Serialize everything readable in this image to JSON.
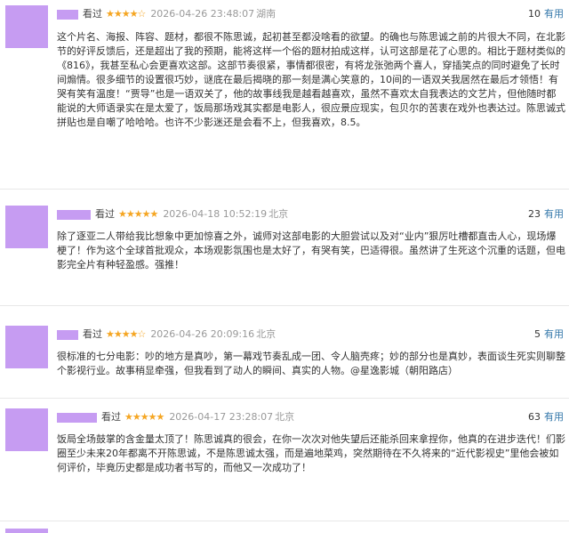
{
  "reviews": [
    {
      "label": "看过",
      "stars": "★★★★☆",
      "date": "2026-04-26 23:48:07",
      "location": "湖南",
      "useful_count": "10",
      "useful_label": "有用",
      "text": "这个片名、海报、阵容、题材，都很不陈思诚，起初甚至都没啥看的欲望。的确也与陈思诚之前的片很大不同，在北影节的好评反馈后，还是超出了我的预期，能将这样一个俗的题材拍成这样，认可这部是花了心思的。相比于题材类似的《816》，我甚至私心会更喜欢这部。这部节奏很紧，事情都很密，有将龙张弛两个喜人，穿插笑点的同时避免了长时间煽情。很多细节的设置很巧妙，谜底在最后揭晓的那一刻是满心笑意的，10间的一语双关我居然在最后才领悟！有哭有笑有温度！“贾导”也是一语双关了，他的故事线我是越看越喜欢，虽然不喜欢太自我表达的文艺片，但他随时都能说的大师语录实在是太爱了，饭局那场戏其实都是电影人，很应景应现实，包贝尔的苦衷在戏外也表达过。陈思诚式拼贴也是自嘲了哈哈哈。也许不少影迷还是会看不上，但我喜欢，8.5。"
    },
    {
      "label": "看过",
      "stars": "★★★★★",
      "date": "2026-04-18 10:52:19",
      "location": "北京",
      "useful_count": "23",
      "useful_label": "有用",
      "text": "除了逐亚二人带给我比想象中更加惊喜之外，诚师对这部电影的大胆尝试以及对“业内”狠厉吐槽都直击人心，现场爆梗了！作为这个全球首批观众，本场观影氛围也是太好了，有哭有笑，巴适得很。虽然讲了生死这个沉重的话题，但电影完全片有种轻盈感。强推！"
    },
    {
      "label": "看过",
      "stars": "★★★★☆",
      "date": "2026-04-26 20:09:16",
      "location": "北京",
      "useful_count": "5",
      "useful_label": "有用",
      "text": "很标准的七分电影：吵的地方是真吵，第一幕戏节奏乱成一团、令人脑壳疼；妙的部分也是真妙，表面谈生死实则聊整个影视行业。故事稍显牵强，但我看到了动人的瞬间、真实的人物。@星逸影城（朝阳路店）"
    },
    {
      "label": "看过",
      "stars": "★★★★★",
      "date": "2026-04-17 23:28:07",
      "location": "北京",
      "useful_count": "63",
      "useful_label": "有用",
      "text": "饭局全场鼓掌的含金量太顶了！陈思诚真的很会，在你一次次对他失望后还能杀回来拿捏你，他真的在进步迭代！们影圈至少未来20年都离不开陈思诚，不是陈思诚太强，而是遍地菜鸡，突然期待在不久将来的“近代影视史”里他会被如何评价，毕竟历史都是成功者书写的，而他又一次成功了！"
    }
  ]
}
